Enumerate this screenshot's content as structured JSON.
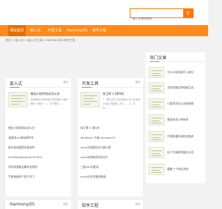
{
  "search": {
    "placeholder": "输入关键词搜索"
  },
  "nav": {
    "items": [
      "网站首页",
      "嵌入式",
      "开发工具",
      "HarmonyOS",
      "软件工程"
    ]
  },
  "breadcrumb": "首页 > 嵌入式 > 嵌入式/工具 > HarmonyOS 软件工程",
  "embedded": {
    "title": "嵌入式",
    "more": "更多",
    "featured_title": "微信小程序网站怎么交",
    "featured_desc": "目录微信小程序网站 如何做好小程序微信小 程序？ 1、打开微信 ……",
    "items": [
      "微信小程序网站怎么交",
      "漫漫流css鼠标事件关",
      "新文档创建是否抛出例",
      "a0338cddabda3d7d7f091",
      "如何用重载运算符合理的",
      "手能电能转个离子学习"
    ]
  },
  "devtools": {
    "title": "开发工具",
    "more": "更多",
    "featured_title": "保卫萝卜2第9关",
    "featured_desc": "1、首先点击下边的蓝色小关 进,使用小道具 开始第二关卡…… 2、然后……",
    "items": [
      "保卫萝卜2第9关",
      "windows7 升级 windows10",
      "word文档图形怎么缩小图",
      "word怎样做对的双分栏",
      "三星a90功能说",
      "excel对应完整的数据"
    ]
  },
  "hot": {
    "title": "热门文章",
    "items": [
      "为什么网站报不上网吗",
      "怎样用微信和电脑互送",
      "小爱同学怎么连接电视",
      "美团外卖订单修改",
      "中国联通在网状态查询",
      "松下空调遥控器怎么用",
      "魔兽三个地址改档"
    ]
  },
  "bottom": {
    "left_title": "HarmonyOS",
    "left_more": "更多",
    "right_title": "软件工程",
    "right_more": "更多"
  }
}
